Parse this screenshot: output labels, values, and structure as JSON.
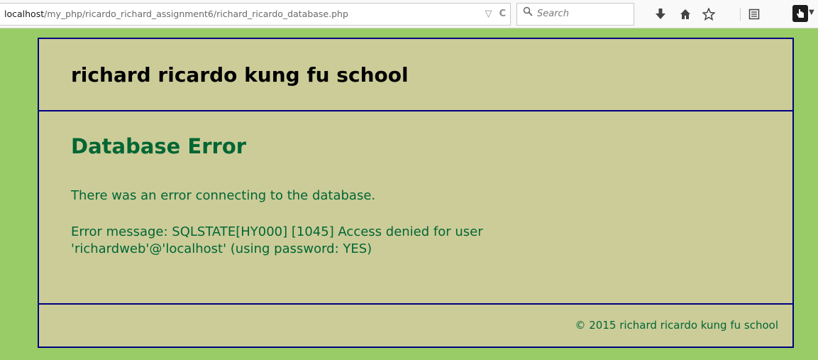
{
  "browser": {
    "url_host": "localhost",
    "url_path": "/my_php/ricardo_richard_assignment6/richard_ricardo_database.php",
    "dropdown_glyph": "▽",
    "reload_glyph": "C",
    "search_placeholder": "Search",
    "icons": [
      "download-icon",
      "home-icon",
      "bookmark-star-icon",
      "reading-list-icon",
      "extension-icon"
    ]
  },
  "header": {
    "title": "richard ricardo kung fu school"
  },
  "main": {
    "heading": "Database Error",
    "message": "There was an error connecting to the database.",
    "error_detail": "Error message: SQLSTATE[HY000] [1045] Access denied for user 'richardweb'@'localhost' (using password: YES)"
  },
  "footer": {
    "copyright": "© 2015 richard ricardo kung fu school"
  },
  "colors": {
    "page_background": "#99cc66",
    "content_background": "#cccc99",
    "border": "#000080",
    "accent_text": "#006633",
    "title_text": "#000000"
  }
}
